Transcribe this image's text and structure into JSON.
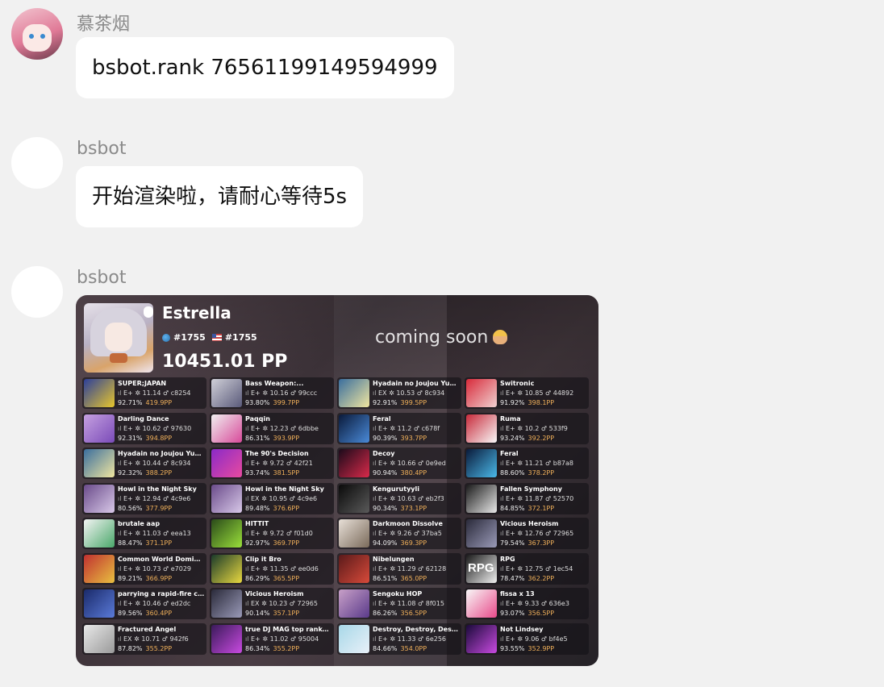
{
  "messages": [
    {
      "sender": "慕茶烟",
      "text": "bsbot.rank 76561199149594999"
    },
    {
      "sender": "bsbot",
      "text": "开始渲染啦，请耐心等待5s"
    },
    {
      "sender": "bsbot"
    }
  ],
  "card": {
    "player": "Estrella",
    "global_rank": "#1755",
    "country_rank": "#1755",
    "pp": "10451.01 PP",
    "banner": "coming soon",
    "scores": [
      {
        "title": "SUPER;JAPAN",
        "diff": "E+",
        "stars": "11.14",
        "hash": "c8254",
        "acc": "92.71%",
        "pp": "419.9PP",
        "c1": "#2c3f9a",
        "c2": "#e7c62c"
      },
      {
        "title": "Darling Dance",
        "diff": "E+",
        "stars": "10.62",
        "hash": "97630",
        "acc": "92.31%",
        "pp": "394.8PP",
        "c1": "#c5a0e0",
        "c2": "#7a4bb8"
      },
      {
        "title": "Hyadain no Joujou Yuujou",
        "diff": "E+",
        "stars": "10.44",
        "hash": "8c934",
        "acc": "92.32%",
        "pp": "388.2PP",
        "c1": "#3a6e9e",
        "c2": "#f0e6a0"
      },
      {
        "title": "Howl in the Night Sky",
        "diff": "E+",
        "stars": "12.94",
        "hash": "4c9e6",
        "acc": "80.56%",
        "pp": "377.9PP",
        "c1": "#6a4b8a",
        "c2": "#d8c8e8"
      },
      {
        "title": "brutale aap",
        "diff": "E+",
        "stars": "11.03",
        "hash": "eea13",
        "acc": "88.47%",
        "pp": "371.1PP",
        "c1": "#f4f4f4",
        "c2": "#4aa86a"
      },
      {
        "title": "Common World Domination",
        "diff": "E+",
        "stars": "10.73",
        "hash": "e7029",
        "acc": "89.21%",
        "pp": "366.9PP",
        "c1": "#c03030",
        "c2": "#e8c040"
      },
      {
        "title": "parrying a rapid-fire comb...",
        "diff": "E+",
        "stars": "10.46",
        "hash": "ed2dc",
        "acc": "89.56%",
        "pp": "360.4PP",
        "c1": "#1a2a6a",
        "c2": "#5a7ad8"
      },
      {
        "title": "Fractured Angel",
        "diff": "EX",
        "stars": "10.71",
        "hash": "942f6",
        "acc": "87.82%",
        "pp": "355.2PP",
        "c1": "#e8e8e8",
        "c2": "#9a9a9a"
      },
      {
        "title": "Bass Weapon:...",
        "diff": "E+",
        "stars": "10.16",
        "hash": "99ccc",
        "acc": "93.80%",
        "pp": "399.7PP",
        "c1": "#d0d0d8",
        "c2": "#5a5a7a"
      },
      {
        "title": "Paqqin",
        "diff": "E+",
        "stars": "12.23",
        "hash": "6dbbe",
        "acc": "86.31%",
        "pp": "393.9PP",
        "c1": "#f0f0f0",
        "c2": "#d84a9a"
      },
      {
        "title": "The 90's Decision",
        "diff": "E+",
        "stars": "9.72",
        "hash": "42f21",
        "acc": "93.74%",
        "pp": "381.5PP",
        "c1": "#8a2ac8",
        "c2": "#e84aa0"
      },
      {
        "title": "Howl in the Night Sky",
        "diff": "EX",
        "stars": "10.95",
        "hash": "4c9e6",
        "acc": "89.48%",
        "pp": "376.6PP",
        "c1": "#6a4b8a",
        "c2": "#d8c8e8"
      },
      {
        "title": "HITTIT",
        "diff": "E+",
        "stars": "9.72",
        "hash": "f01d0",
        "acc": "92.97%",
        "pp": "369.7PP",
        "c1": "#2a4a1a",
        "c2": "#9ae03a"
      },
      {
        "title": "Clip it Bro",
        "diff": "E+",
        "stars": "11.35",
        "hash": "ee0d6",
        "acc": "86.29%",
        "pp": "365.5PP",
        "c1": "#1a3a2a",
        "c2": "#e8d840"
      },
      {
        "title": "Vicious Heroism",
        "diff": "EX",
        "stars": "10.23",
        "hash": "72965",
        "acc": "90.14%",
        "pp": "357.1PP",
        "c1": "#2a2a3a",
        "c2": "#9a9ab8"
      },
      {
        "title": "true DJ MAG top ranker's...",
        "diff": "E+",
        "stars": "11.02",
        "hash": "95004",
        "acc": "86.34%",
        "pp": "355.2PP",
        "c1": "#3a1a5a",
        "c2": "#c84ae0"
      },
      {
        "title": "Hyadain no Joujou Yuujou",
        "diff": "EX",
        "stars": "10.53",
        "hash": "8c934",
        "acc": "92.91%",
        "pp": "399.5PP",
        "c1": "#3a6e9e",
        "c2": "#f0e6a0"
      },
      {
        "title": "Feral",
        "diff": "E+",
        "stars": "11.2",
        "hash": "c678f",
        "acc": "90.39%",
        "pp": "393.7PP",
        "c1": "#0a1a3a",
        "c2": "#4a8ad8"
      },
      {
        "title": "Decoy",
        "diff": "E+",
        "stars": "10.66",
        "hash": "0e9ed",
        "acc": "90.94%",
        "pp": "380.4PP",
        "c1": "#1a0a1a",
        "c2": "#d82a4a"
      },
      {
        "title": "Kengurutyyli",
        "diff": "E+",
        "stars": "10.63",
        "hash": "eb2f3",
        "acc": "90.34%",
        "pp": "373.1PP",
        "c1": "#0a0a0a",
        "c2": "#5a5a5a"
      },
      {
        "title": "Darkmoon Dissolve",
        "diff": "E+",
        "stars": "9.26",
        "hash": "37ba5",
        "acc": "94.09%",
        "pp": "369.3PP",
        "c1": "#e8e0d8",
        "c2": "#7a6a5a"
      },
      {
        "title": "Nibelungen",
        "diff": "E+",
        "stars": "11.29",
        "hash": "62128",
        "acc": "86.51%",
        "pp": "365.0PP",
        "c1": "#5a1a1a",
        "c2": "#d84a3a"
      },
      {
        "title": "Sengoku HOP",
        "diff": "E+",
        "stars": "11.08",
        "hash": "8f015",
        "acc": "86.26%",
        "pp": "356.5PP",
        "c1": "#c8a0c8",
        "c2": "#5a3a8a"
      },
      {
        "title": "Destroy, Destroy, Destroy...",
        "diff": "E+",
        "stars": "11.33",
        "hash": "6e256",
        "acc": "84.66%",
        "pp": "354.0PP",
        "c1": "#a8d8e8",
        "c2": "#e8f0f8"
      },
      {
        "title": "Switronic",
        "diff": "E+",
        "stars": "10.85",
        "hash": "44892",
        "acc": "91.92%",
        "pp": "398.1PP",
        "c1": "#d82a3a",
        "c2": "#f0d0d0"
      },
      {
        "title": "Ruma",
        "diff": "E+",
        "stars": "10.2",
        "hash": "533f9",
        "acc": "93.24%",
        "pp": "392.2PP",
        "c1": "#c82a3a",
        "c2": "#f8f8f8"
      },
      {
        "title": "Feral",
        "diff": "E+",
        "stars": "11.21",
        "hash": "b87a8",
        "acc": "88.60%",
        "pp": "378.2PP",
        "c1": "#0a1a3a",
        "c2": "#4ab8e8"
      },
      {
        "title": "Fallen Symphony",
        "diff": "E+",
        "stars": "11.87",
        "hash": "52570",
        "acc": "84.85%",
        "pp": "372.1PP",
        "c1": "#1a1a1a",
        "c2": "#e8e8e8"
      },
      {
        "title": "Vicious Heroism",
        "diff": "E+",
        "stars": "12.76",
        "hash": "72965",
        "acc": "79.54%",
        "pp": "367.3PP",
        "c1": "#2a2a3a",
        "c2": "#9a9ab8"
      },
      {
        "title": "RPG",
        "diff": "E+",
        "stars": "12.75",
        "hash": "1ec54",
        "acc": "78.47%",
        "pp": "362.2PP",
        "c1": "#1a1a1a",
        "c2": "#f0f0f0",
        "label": "RPG"
      },
      {
        "title": "fissa x 13",
        "diff": "E+",
        "stars": "9.33",
        "hash": "636e3",
        "acc": "93.07%",
        "pp": "356.5PP",
        "c1": "#f8f8f8",
        "c2": "#e84a8a"
      },
      {
        "title": "Not Lindsey",
        "diff": "E+",
        "stars": "9.06",
        "hash": "bf4e5",
        "acc": "93.55%",
        "pp": "352.9PP",
        "c1": "#1a0a3a",
        "c2": "#c84ae0"
      }
    ]
  }
}
